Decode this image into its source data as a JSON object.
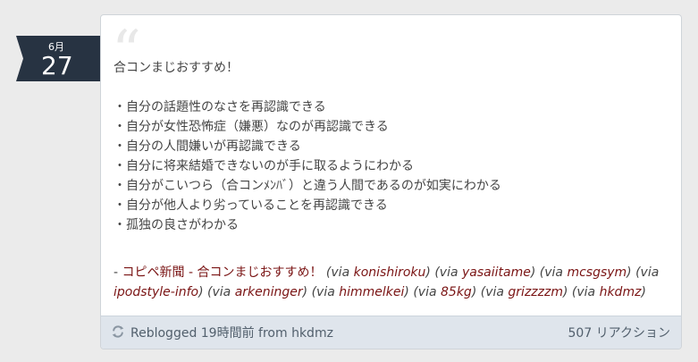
{
  "date": {
    "month": "6月",
    "day": "27"
  },
  "quote": {
    "mark": "“",
    "lines": [
      "合コンまじおすすめ！",
      "",
      "・自分の話題性のなさを再認識できる",
      "・自分が女性恐怖症（嫌悪）なのが再認識できる",
      "・自分の人間嫌いが再認識できる",
      "・自分に将来結婚できないのが手に取るようにわかる",
      "・自分がこいつら（合コンﾒﾝﾊﾞ）と違う人間であるのが如実にわかる",
      "・自分が他人より劣っていることを再認識できる",
      "・孤独の良さがわかる"
    ]
  },
  "source": {
    "prefix": "- ",
    "title": "コピペ新聞 - 合コンまじおすすめ！",
    "vias": [
      "konishiroku",
      "yasaiitame",
      "mcsgsym",
      "ipodstyle-info",
      "arkeninger",
      "himmelkei",
      "85kg",
      "grizzzzm",
      "hkdmz"
    ],
    "via_label": "via"
  },
  "footer": {
    "reblog_text": "Reblogged 19時間前 from ",
    "reblog_user": "hkdmz",
    "reactions": "507 リアクション"
  },
  "colors": {
    "date_flag": "#273342",
    "link": "#7a1414",
    "footer_bg": "#dfe5ec",
    "page_bg": "#ebebeb"
  },
  "icons": {
    "reblog": "reblog-icon"
  }
}
